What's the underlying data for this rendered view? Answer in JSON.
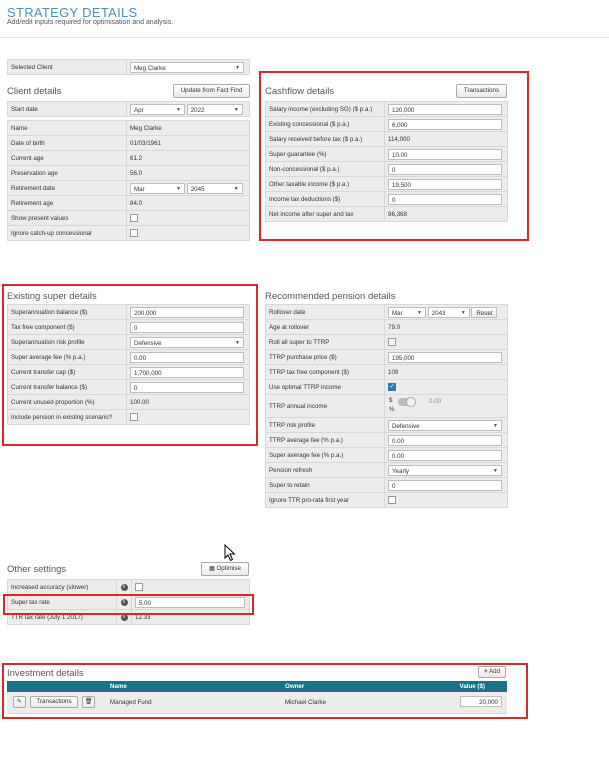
{
  "page": {
    "title": "STRATEGY DETAILS",
    "subtitle": "Add/edit inputs required for optimisation and analysis."
  },
  "selected_client": {
    "label": "Selected Client",
    "value": "Meg Clarke"
  },
  "client": {
    "title": "Client details",
    "update_button": "Update from Fact Find",
    "start_date_label": "Start date",
    "start_month": "Apr",
    "start_year": "2022",
    "name_label": "Name",
    "name": "Meg Clarke",
    "dob_label": "Date of birth",
    "dob": "01/03/1961",
    "age_label": "Current age",
    "age": "61.2",
    "preservation_label": "Preservation age",
    "preservation": "56.0",
    "retirement_date_label": "Retirement date",
    "retirement_month": "Mar",
    "retirement_year": "2045",
    "retirement_age_label": "Retirement age",
    "retirement_age": "84.0",
    "show_present_label": "Show present values",
    "ignore_catchup_label": "Ignore catch-up concessional"
  },
  "cashflow": {
    "title": "Cashflow details",
    "transactions_button": "Transactions",
    "rows": [
      {
        "label": "Salary income (excluding SG) ($ p.a.)",
        "value": "120,000",
        "readonly": false
      },
      {
        "label": "Existing concessional ($ p.a.)",
        "value": "6,000",
        "readonly": false
      },
      {
        "label": "Salary received before tax ($ p.a.)",
        "value": "114,000",
        "readonly": true
      },
      {
        "label": "Super guarantee (%)",
        "value": "10.00",
        "readonly": false
      },
      {
        "label": "Non-concessional ($ p.a.)",
        "value": "0",
        "readonly": false
      },
      {
        "label": "Other taxable income ($ p.a.)",
        "value": "19,500",
        "readonly": false
      },
      {
        "label": "Income tax deductions ($)",
        "value": "0",
        "readonly": false
      },
      {
        "label": "Net income after super and tax",
        "value": "96,368",
        "readonly": true
      }
    ]
  },
  "super": {
    "title": "Existing super details",
    "balance_label": "Superannuation balance ($)",
    "balance": "200,000",
    "taxfree_label": "Tax free component ($)",
    "taxfree": "0",
    "risk_label": "Superannuation risk profile",
    "risk": "Defensive",
    "fee_label": "Super average fee (% p.a.)",
    "fee": "0.00",
    "cap_label": "Current transfer cap ($)",
    "cap": "1,700,000",
    "transfer_label": "Current transfer balance ($)",
    "transfer": "0",
    "unused_label": "Current unused proportion (%)",
    "unused": "100.00",
    "include_label": "Include pension in existing scenario?"
  },
  "pension": {
    "title": "Recommended pension details",
    "rollover_label": "Rollover date",
    "rollover_month": "Mar",
    "rollover_year": "2043",
    "reset_button": "Reset",
    "age_label": "Age at rollover",
    "age": "79.0",
    "rollall_label": "Roll all super to TTRP",
    "purchase_label": "TTRP purchase price ($)",
    "purchase": "195,000",
    "ttrp_taxfree_label": "TTRP tax free component ($)",
    "ttrp_taxfree": "109",
    "optimal_label": "Use optimal TTRP income",
    "annual_label": "TTRP annual income",
    "annual_dollar": "$",
    "annual_pct": "%",
    "annual_value": "0.00",
    "risk_label": "TTRP risk profile",
    "risk": "Defensive",
    "ttrp_fee_label": "TTRP average fee (% p.a.)",
    "ttrp_fee": "0.00",
    "super_fee_label": "Super average fee (% p.a.)",
    "super_fee": "0.00",
    "refresh_label": "Pension refresh",
    "refresh": "Yearly",
    "retain_label": "Super to retain",
    "retain": "0",
    "ignore_label": "Ignore TTR pro-rata first year"
  },
  "other": {
    "title": "Other settings",
    "optimise_button": "Optimise",
    "accuracy_label": "Increased accuracy (slower)",
    "tax_label": "Super tax rate",
    "tax": "5.00",
    "ttr_label": "TTR tax rate (July 1 2017)",
    "ttr": "12.33"
  },
  "investment": {
    "title": "Investment details",
    "add_button": "Add",
    "columns": [
      "Name",
      "Owner",
      "Value ($)"
    ],
    "transactions_button": "Transactions",
    "row": {
      "name": "Managed Fund",
      "owner": "Michael Clarke",
      "value": "20,000"
    }
  },
  "colors": {
    "accent": "#4a90c4",
    "table_header": "#1b7188",
    "highlight": "#d42a2a"
  }
}
